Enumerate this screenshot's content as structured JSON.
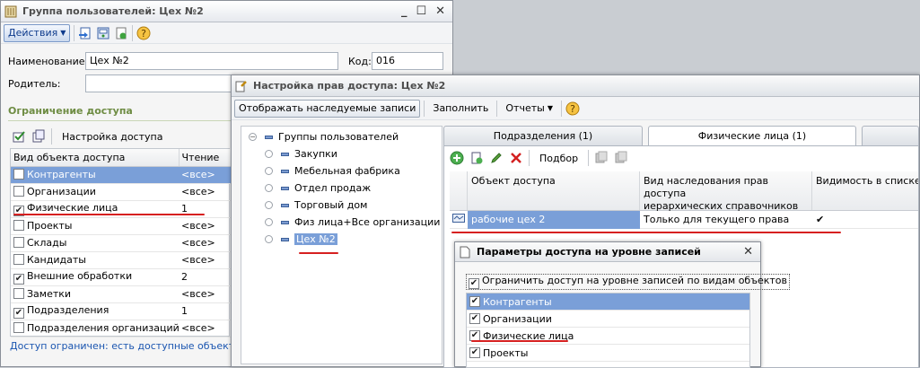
{
  "win1": {
    "title": "Группа пользователей: Цех №2",
    "actions_label": "Действия",
    "name_label": "Наименование:",
    "name_value": "Цех №2",
    "code_label": "Код:",
    "code_value": "016",
    "parent_label": "Родитель:",
    "parent_value": "",
    "section_title": "Ограничение доступа",
    "access_setup_label": "Настройка доступа",
    "col_object": "Вид объекта доступа",
    "col_read": "Чтение",
    "rows": [
      {
        "label": "Контрагенты",
        "checked": false,
        "value": "<все>",
        "selected": true
      },
      {
        "label": "Организации",
        "checked": false,
        "value": "<все>",
        "selected": false
      },
      {
        "label": "Физические лица",
        "checked": true,
        "value": "1",
        "selected": false
      },
      {
        "label": "Проекты",
        "checked": false,
        "value": "<все>",
        "selected": false
      },
      {
        "label": "Склады",
        "checked": false,
        "value": "<все>",
        "selected": false
      },
      {
        "label": "Кандидаты",
        "checked": false,
        "value": "<все>",
        "selected": false
      },
      {
        "label": "Внешние обработки",
        "checked": true,
        "value": "2",
        "selected": false
      },
      {
        "label": "Заметки",
        "checked": false,
        "value": "<все>",
        "selected": false
      },
      {
        "label": "Подразделения",
        "checked": true,
        "value": "1",
        "selected": false
      },
      {
        "label": "Подразделения организаций",
        "checked": false,
        "value": "<все>",
        "selected": false
      }
    ],
    "status_text": "Доступ ограничен: есть доступные объекты"
  },
  "win2": {
    "title": "Настройка прав доступа: Цех №2",
    "btn_inherited": "Отображать наследуемые записи",
    "btn_fill": "Заполнить",
    "btn_reports": "Отчеты",
    "tree": [
      {
        "label": "Группы пользователей",
        "root": true
      },
      {
        "label": "Закупки",
        "root": false
      },
      {
        "label": "Мебельная фабрика",
        "root": false
      },
      {
        "label": "Отдел продаж",
        "root": false
      },
      {
        "label": "Торговый дом",
        "root": false
      },
      {
        "label": "Физ лица+Все организации",
        "root": false
      },
      {
        "label": "Цех №2",
        "root": false
      }
    ],
    "tabs": [
      "Подразделения (1)",
      "Физические лица (1)"
    ],
    "pick_label": "Подбор",
    "col_object": "Объект доступа",
    "col_inherit_1": "Вид наследования прав доступа",
    "col_inherit_2": "иерархических справочников",
    "col_visibility": "Видимость в списке",
    "row_object": "рабочие цех 2",
    "row_inherit": "Только для текущего права",
    "row_visibility": "✔"
  },
  "win3": {
    "title": "Параметры доступа на уровне записей",
    "restrict_label": "Ограничить доступ на уровне записей по видам объектов",
    "items": [
      {
        "label": "Контрагенты",
        "selected": true
      },
      {
        "label": "Организации",
        "selected": false
      },
      {
        "label": "Физические лица",
        "selected": false
      },
      {
        "label": "Проекты",
        "selected": false
      }
    ]
  },
  "colors": {
    "selection": "#7a9fd8",
    "section_green": "#6e8c43",
    "underline_red": "#d62020",
    "link_blue": "#1a55b0"
  }
}
